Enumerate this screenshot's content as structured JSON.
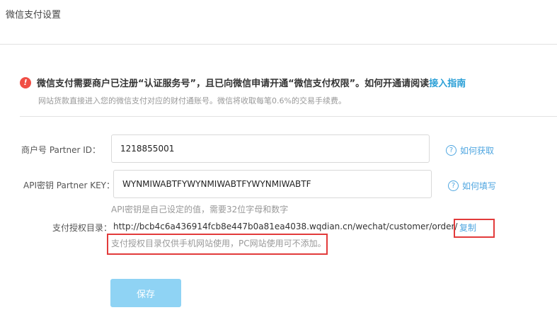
{
  "page": {
    "title": "微信支付设置"
  },
  "notice": {
    "main_text": "微信支付需要商户已注册“认证服务号”，且已向微信申请开通“微信支付权限”。如何开通请阅读",
    "link_text": "接入指南",
    "sub_text": "网站货款直接进入您的微信支付对应的财付通账号。微信将收取每笔0.6%的交易手续费。",
    "icon": "exclamation-icon",
    "icon_color": "#f04e45"
  },
  "form": {
    "partner_id": {
      "label": "商户号  Partner   ID：",
      "value": "1218855001",
      "help_text": "如何获取"
    },
    "partner_key": {
      "label": "API密钥 Partner KEY：",
      "value": "WYNMIWABTFYWYNMIWABTFYWYNMIWABTF",
      "help_text": "如何填写",
      "hint": "API密钥是自己设定的值，需要32位字母和数字"
    },
    "auth_dir": {
      "label": "支付授权目录：",
      "value": "http://bcb4c6a436914fcb8e447b0a81ea4038.wqdian.cn/wechat/customer/order/",
      "copy_text": "复制",
      "note": "支付授权目录仅供手机网站使用，PC网站使用可不添加。"
    },
    "save_label": "保存"
  },
  "colors": {
    "accent": "#4fa6e0",
    "save_button": "#8fd3f4",
    "highlight_border": "#e23b3b"
  }
}
